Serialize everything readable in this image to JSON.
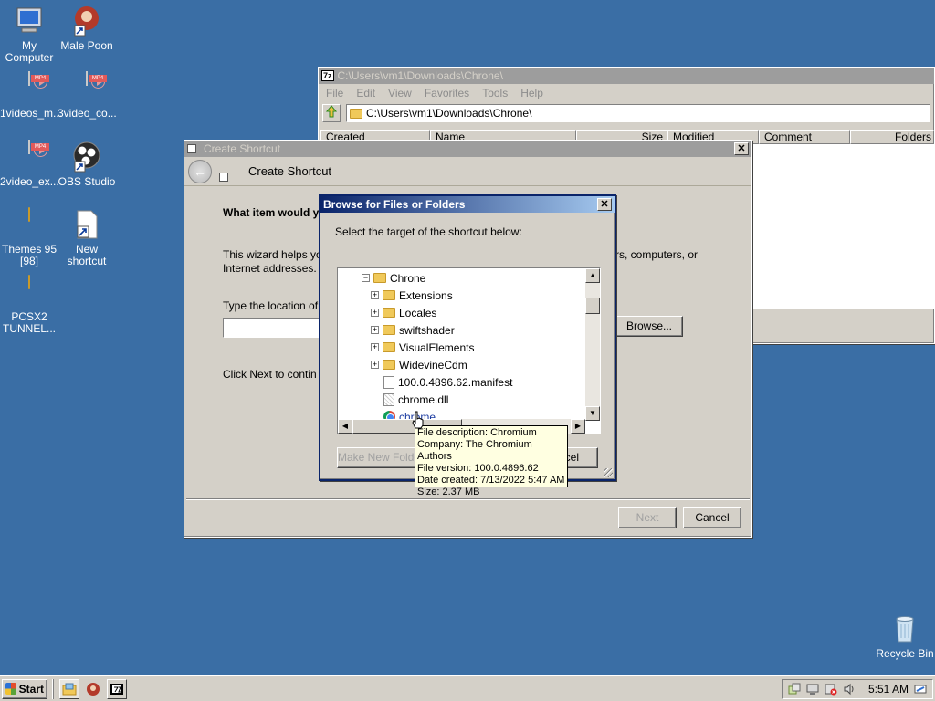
{
  "desktop": {
    "icons": [
      {
        "label": "My Computer",
        "icon": "my-computer-icon"
      },
      {
        "label": "Male Poon",
        "icon": "app-shortcut-icon"
      },
      {
        "label": "1videos_m...",
        "icon": "mp4-file-icon",
        "badge": "MP4"
      },
      {
        "label": "3video_co...",
        "icon": "mp4-file-icon",
        "badge": "MP4"
      },
      {
        "label": "2video_ex...",
        "icon": "mp4-file-icon",
        "badge": "MP4"
      },
      {
        "label": "OBS Studio",
        "icon": "obs-studio-icon"
      },
      {
        "label": "Themes 95 [98]",
        "icon": "folder-icon"
      },
      {
        "label": "New shortcut",
        "icon": "shortcut-icon"
      },
      {
        "label": "PCSX2 TUNNEL...",
        "icon": "folder-icon"
      },
      {
        "label": "Recycle Bin",
        "icon": "recycle-bin-icon"
      }
    ]
  },
  "zip_window": {
    "title_badge": "7z",
    "title": "C:\\Users\\vm1\\Downloads\\Chrone\\",
    "menu": [
      "File",
      "Edit",
      "View",
      "Favorites",
      "Tools",
      "Help"
    ],
    "address": "C:\\Users\\vm1\\Downloads\\Chrone\\",
    "columns": [
      "Created",
      "Name",
      "Size",
      "Modified",
      "Comment",
      "Folders"
    ]
  },
  "wizard": {
    "title": "Create Shortcut",
    "header": "Create Shortcut",
    "question": "What item would yo",
    "help_left": "This wizard helps yo",
    "help_right": "rs, computers, or",
    "help_line2": "Internet addresses.",
    "type_label": "Type the location of",
    "browse_label": "Browse...",
    "next_text": "Click Next to contin",
    "next_button": "Next",
    "cancel_button": "Cancel"
  },
  "browse_dialog": {
    "title": "Browse for Files or Folders",
    "instruction": "Select the target of the shortcut below:",
    "tree": {
      "root": "Chrone",
      "folders": [
        "Extensions",
        "Locales",
        "swiftshader",
        "VisualElements",
        "WidevineCdm"
      ],
      "files": [
        "100.0.4896.62.manifest",
        "chrome.dll"
      ],
      "selected": "chrome"
    },
    "new_folder_button": "Make New Folde",
    "cancel_partial": "cel"
  },
  "tooltip": {
    "lines": [
      "File description: Chromium",
      "Company: The Chromium Authors",
      "File version: 100.0.4896.62",
      "Date created: 7/13/2022 5:47 AM",
      "Size: 2.37 MB"
    ]
  },
  "taskbar": {
    "start_label": "Start",
    "clock": "5:51 AM"
  }
}
